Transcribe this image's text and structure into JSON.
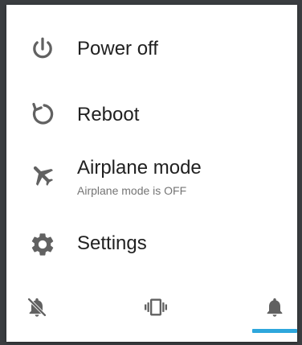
{
  "menu": {
    "power_off": {
      "label": "Power off",
      "icon": "power-icon"
    },
    "reboot": {
      "label": "Reboot",
      "icon": "reboot-icon"
    },
    "airplane": {
      "label": "Airplane mode",
      "sublabel": "Airplane mode is OFF",
      "icon": "airplane-icon"
    },
    "settings": {
      "label": "Settings",
      "icon": "gear-icon"
    }
  },
  "sound_modes": {
    "options": [
      {
        "name": "mute",
        "icon": "bell-off-icon"
      },
      {
        "name": "vibrate",
        "icon": "vibrate-icon"
      },
      {
        "name": "ring",
        "icon": "bell-icon"
      }
    ],
    "selected": "ring"
  },
  "colors": {
    "icon": "#616161",
    "text": "#212121",
    "subtext": "#757575",
    "accent": "#2ea7dc"
  }
}
